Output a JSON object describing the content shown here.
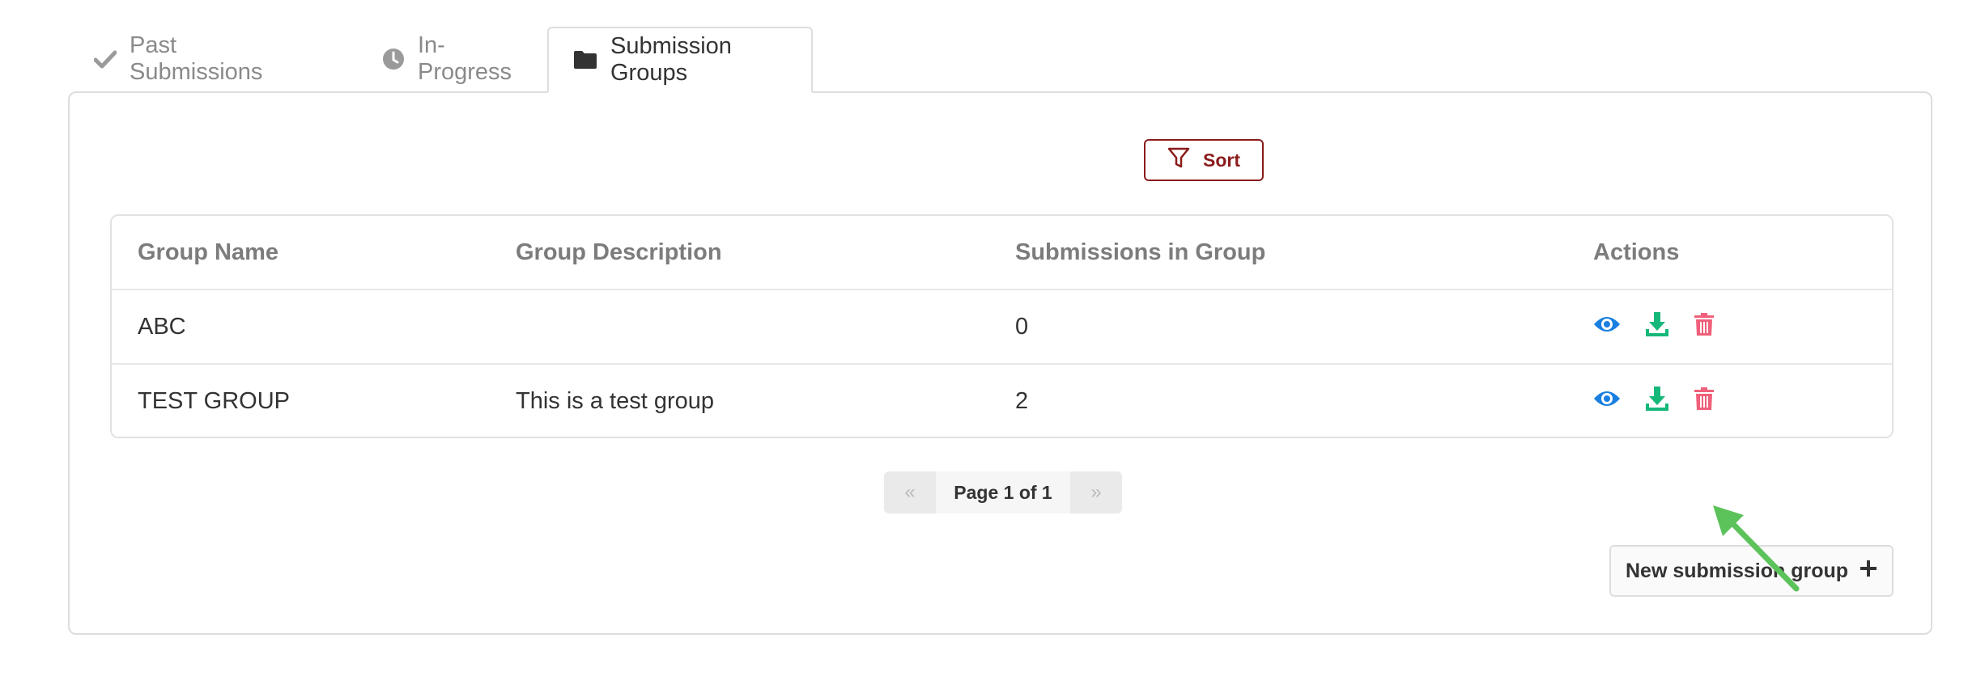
{
  "tabs": [
    {
      "label": "Past Submissions",
      "icon": "check-icon",
      "active": false
    },
    {
      "label": "In-Progress",
      "icon": "clock-icon",
      "active": false
    },
    {
      "label": "Submission Groups",
      "icon": "folder-icon",
      "active": true
    }
  ],
  "toolbar": {
    "sort_label": "Sort",
    "sort_icon": "filter-icon"
  },
  "table": {
    "columns": [
      "Group Name",
      "Group Description",
      "Submissions in Group",
      "Actions"
    ],
    "rows": [
      {
        "name": "ABC",
        "description": "",
        "count": "0"
      },
      {
        "name": "TEST GROUP",
        "description": "This is a test group",
        "count": "2"
      }
    ],
    "action_icons": [
      "eye-icon",
      "download-icon",
      "trash-icon"
    ]
  },
  "pagination": {
    "prev": "«",
    "label": "Page 1 of 1",
    "next": "»"
  },
  "new_group_button": {
    "label": "New submission group",
    "icon": "plus-icon"
  },
  "colors": {
    "view": "#1a7fe0",
    "download": "#16b87a",
    "delete": "#f0607a",
    "sort_accent": "#8b1c1c",
    "annotation_arrow": "#5cc25a"
  }
}
